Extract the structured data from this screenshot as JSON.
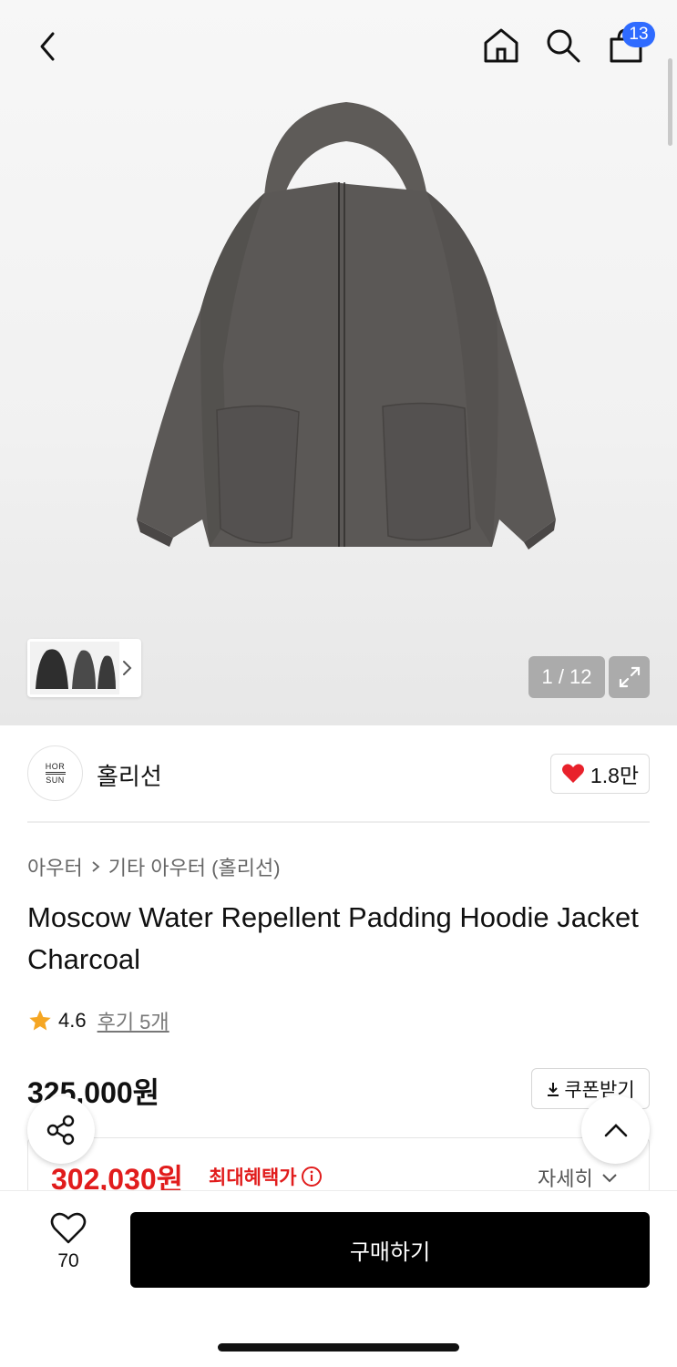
{
  "header": {
    "cart_count": "13",
    "icons": [
      "back-arrow-icon",
      "home-icon",
      "search-icon",
      "bag-icon"
    ]
  },
  "gallery": {
    "counter": "1 / 12",
    "icons": [
      "chevron-right-icon",
      "expand-icon"
    ]
  },
  "brand": {
    "name": "홀리선",
    "logo_text_top": "HOR",
    "logo_text_bottom": "SUN",
    "likes": "1.8만"
  },
  "breadcrumb": {
    "level1": "아우터",
    "level2": "기타 아우터 (홀리선)"
  },
  "product": {
    "title": "Moscow Water Repellent Padding Hoodie Jacket Charcoal",
    "rating": "4.6",
    "reviews": "후기 5개",
    "price": "325,000원",
    "coupon_label": "쿠폰받기",
    "sale_price": "302,030원",
    "max_benefit_label": "최대혜택가",
    "detail_label": "자세히"
  },
  "bottom": {
    "wish_count": "70",
    "buy_label": "구매하기"
  },
  "colors": {
    "accent_red": "#e11c1c",
    "badge_blue": "#2f6bff",
    "star": "#f5a623",
    "heart": "#e8212b"
  }
}
